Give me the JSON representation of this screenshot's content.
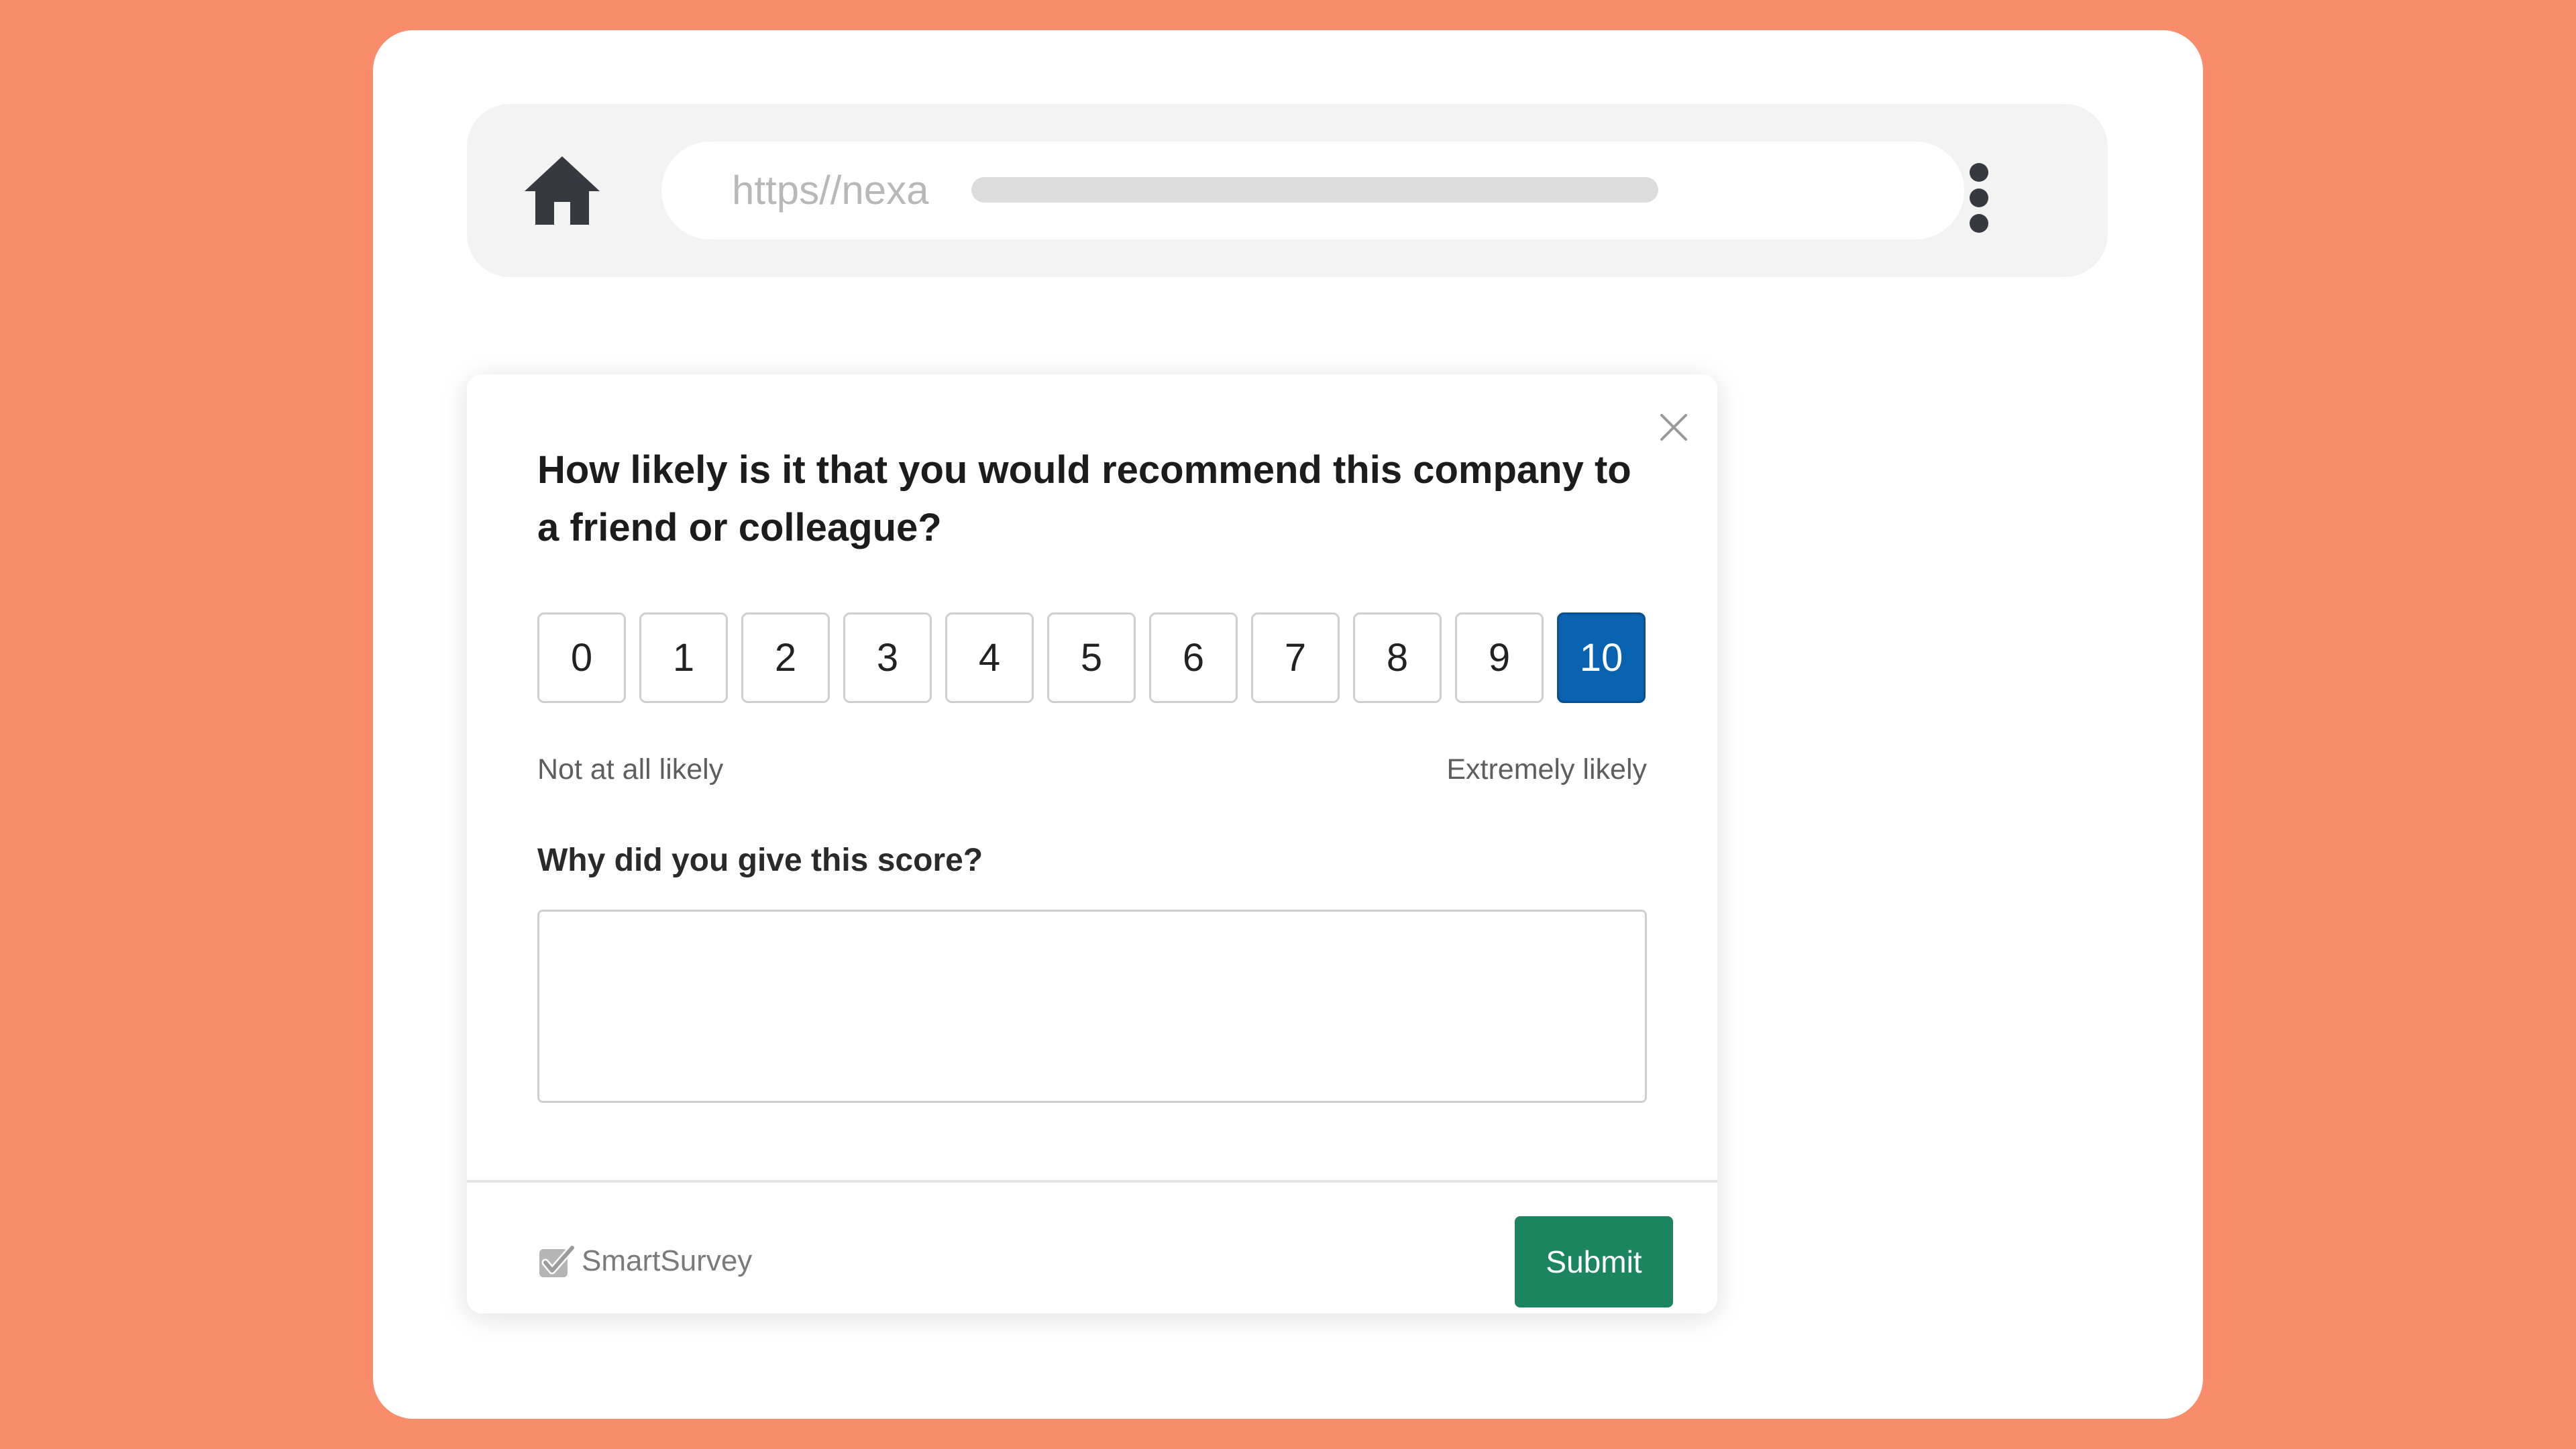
{
  "address_bar": {
    "url": "https//nexa"
  },
  "survey": {
    "question": "How likely is it that you would recommend this company to a friend or colleague?",
    "scale": {
      "options": [
        "0",
        "1",
        "2",
        "3",
        "4",
        "5",
        "6",
        "7",
        "8",
        "9",
        "10"
      ],
      "selected": "10",
      "low_label": "Not at all likely",
      "high_label": "Extremely likely"
    },
    "why_label": "Why did you give this score?",
    "reason_value": "",
    "brand": "SmartSurvey",
    "submit_label": "Submit"
  },
  "colors": {
    "background": "#F98C6B",
    "selected": "#0962B0",
    "submit": "#1B8560"
  },
  "icons": {
    "home": "home-icon",
    "menu": "kebab-menu-icon",
    "close": "close-icon",
    "brand": "checkbox-check-icon"
  }
}
